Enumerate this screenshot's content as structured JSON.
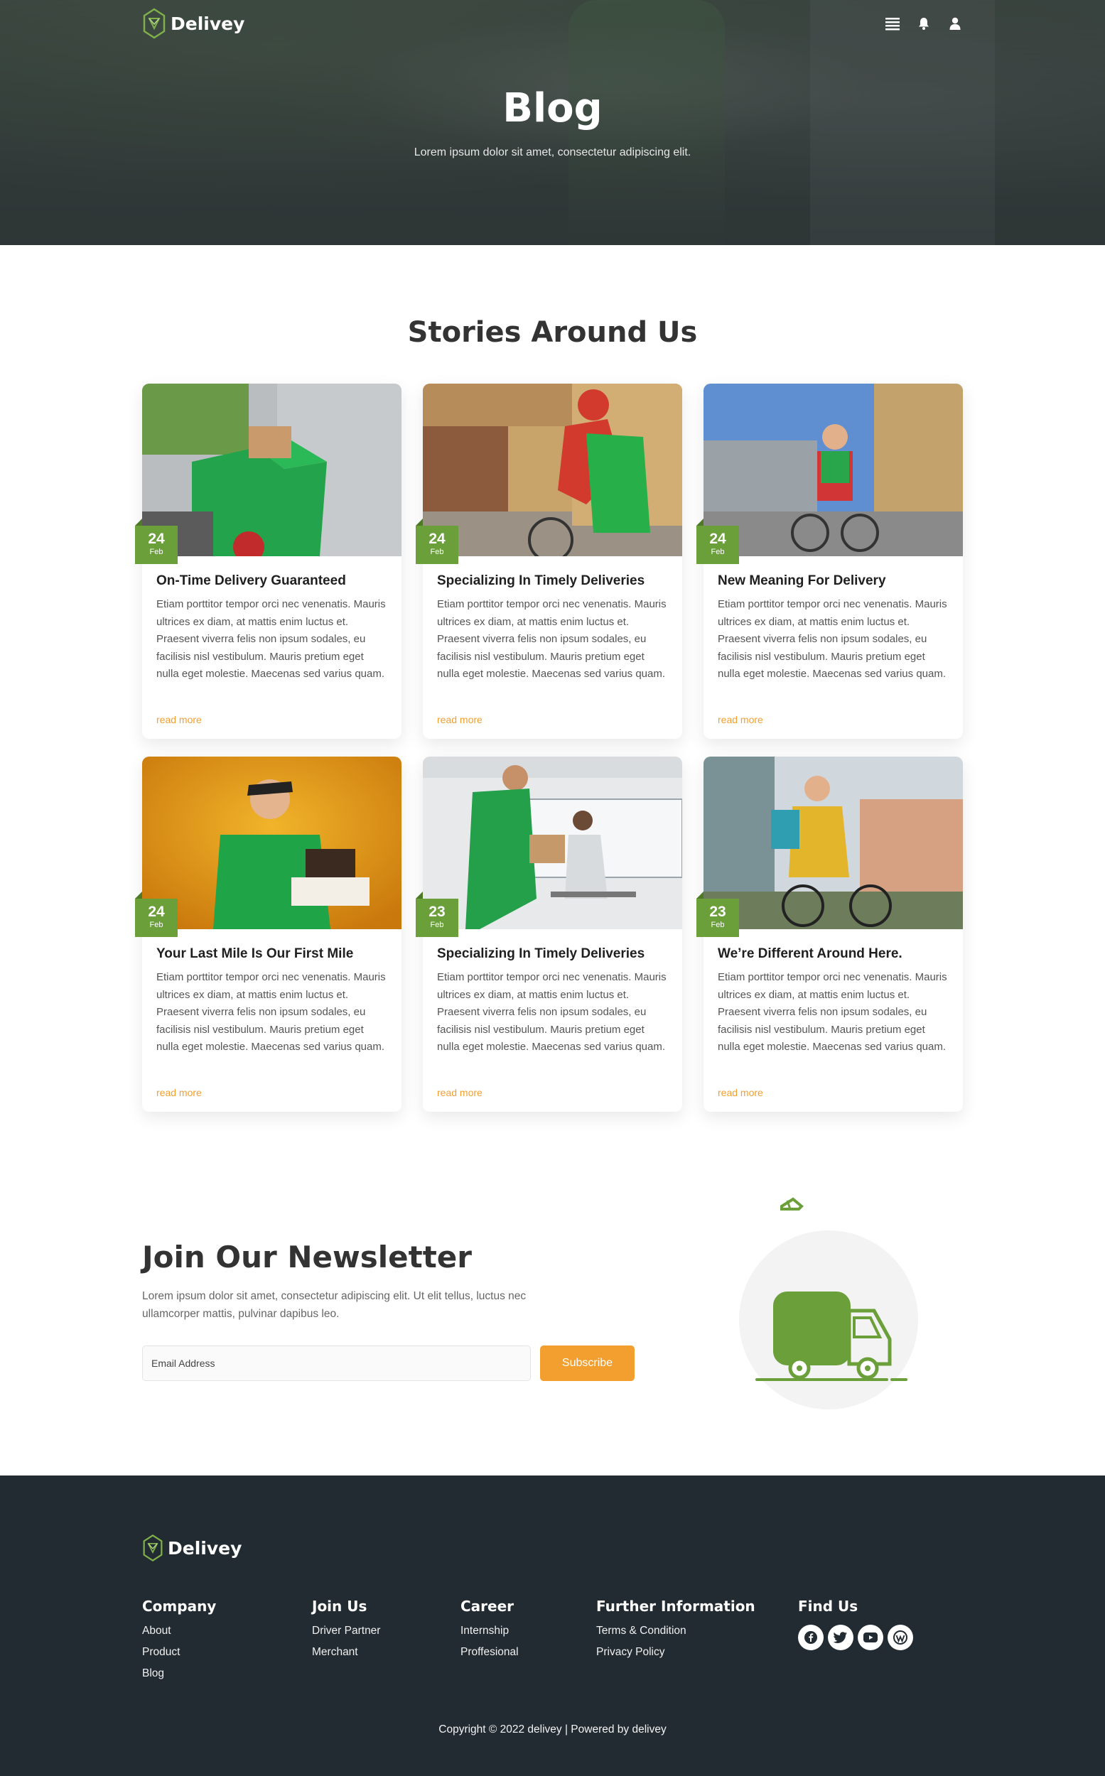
{
  "header": {
    "brand": "Delivey",
    "icons": [
      "menu-icon",
      "bell-icon",
      "user-icon"
    ]
  },
  "hero": {
    "title": "Blog",
    "subtitle": "Lorem ipsum dolor sit amet, consectetur adipiscing elit."
  },
  "stories": {
    "title": "Stories Around Us",
    "read_more": "read more",
    "cards": [
      {
        "day": "24",
        "month": "Feb",
        "title": "On-Time Delivery Guaranteed",
        "text": "Etiam porttitor tempor orci nec venenatis. Mauris ultrices ex diam, at mattis enim luctus et. Praesent viverra felis non ipsum sodales, eu facilisis nisl vestibulum. Mauris pretium eget nulla eget molestie. Maecenas sed varius quam.",
        "link": "read more"
      },
      {
        "day": "24",
        "month": "Feb",
        "title": "Specializing In Timely Deliveries",
        "text": "Etiam porttitor tempor orci nec venenatis. Mauris ultrices ex diam, at mattis enim luctus et. Praesent viverra felis non ipsum sodales, eu facilisis nisl vestibulum. Mauris pretium eget nulla eget molestie. Maecenas sed varius quam.",
        "link": "read more"
      },
      {
        "day": "24",
        "month": "Feb",
        "title": "New Meaning For Delivery",
        "text": "Etiam porttitor tempor orci nec venenatis. Mauris ultrices ex diam, at mattis enim luctus et. Praesent viverra felis non ipsum sodales, eu facilisis nisl vestibulum. Mauris pretium eget nulla eget molestie. Maecenas sed varius quam.",
        "link": "read more"
      },
      {
        "day": "24",
        "month": "Feb",
        "title": "Your Last Mile Is Our First Mile",
        "text": "Etiam porttitor tempor orci nec venenatis. Mauris ultrices ex diam, at mattis enim luctus et. Praesent viverra felis non ipsum sodales, eu facilisis nisl vestibulum. Mauris pretium eget nulla eget molestie. Maecenas sed varius quam.",
        "link": "read more"
      },
      {
        "day": "23",
        "month": "Feb",
        "title": "Specializing In Timely Deliveries",
        "text": "Etiam porttitor tempor orci nec venenatis. Mauris ultrices ex diam, at mattis enim luctus et. Praesent viverra felis non ipsum sodales, eu facilisis nisl vestibulum. Mauris pretium eget nulla eget molestie. Maecenas sed varius quam.",
        "link": "read more"
      },
      {
        "day": "23",
        "month": "Feb",
        "title": "We’re Different Around Here.",
        "text": "Etiam porttitor tempor orci nec venenatis. Mauris ultrices ex diam, at mattis enim luctus et. Praesent viverra felis non ipsum sodales, eu facilisis nisl vestibulum. Mauris pretium eget nulla eget molestie. Maecenas sed varius quam.",
        "link": "read more"
      }
    ]
  },
  "newsletter": {
    "title": "Join Our Newsletter",
    "text": "Lorem ipsum dolor sit amet, consectetur adipiscing elit. Ut elit tellus, luctus nec ullamcorper mattis, pulvinar dapibus leo.",
    "placeholder": "Email Address",
    "button": "Subscribe"
  },
  "footer": {
    "brand": "Delivey",
    "columns": [
      {
        "title": "Company",
        "links": [
          "About",
          "Product",
          "Blog"
        ]
      },
      {
        "title": "Join Us",
        "links": [
          "Driver Partner",
          "Merchant"
        ]
      },
      {
        "title": "Career",
        "links": [
          "Internship",
          "Proffesional"
        ]
      },
      {
        "title": "Further Information",
        "links": [
          "Terms & Condition",
          "Privacy Policy"
        ]
      }
    ],
    "find_us": {
      "title": "Find Us",
      "icons": [
        "facebook-icon",
        "twitter-icon",
        "youtube-icon",
        "wordpress-icon"
      ]
    },
    "copyright": "Copyright © 2022 delivey | Powered by delivey"
  },
  "colors": {
    "brand_green": "#6a9f3a",
    "accent_orange": "#f29f30",
    "footer_bg": "#232b32"
  }
}
